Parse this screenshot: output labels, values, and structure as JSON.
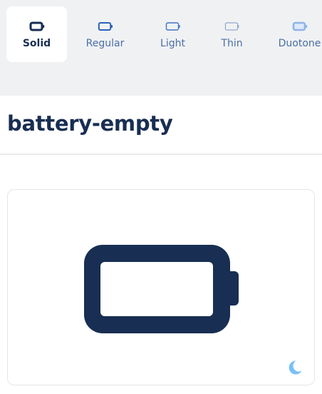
{
  "style_tabs": [
    {
      "label": "Solid",
      "icon": "battery-solid-icon",
      "active": true
    },
    {
      "label": "Regular",
      "icon": "battery-regular-icon",
      "active": false
    },
    {
      "label": "Light",
      "icon": "battery-light-icon",
      "active": false
    },
    {
      "label": "Thin",
      "icon": "battery-thin-icon",
      "active": false
    },
    {
      "label": "Duotone",
      "icon": "battery-duotone-icon",
      "active": false
    }
  ],
  "icon_name": "battery-empty",
  "preview": {
    "icon": "battery-empty-icon",
    "mode_toggle_icon": "moon-icon"
  },
  "colors": {
    "primary": "#182e52",
    "tab_text": "#4a6fa5",
    "tab_bar_bg": "#f0f1f3",
    "moon": "#79c0f5"
  }
}
